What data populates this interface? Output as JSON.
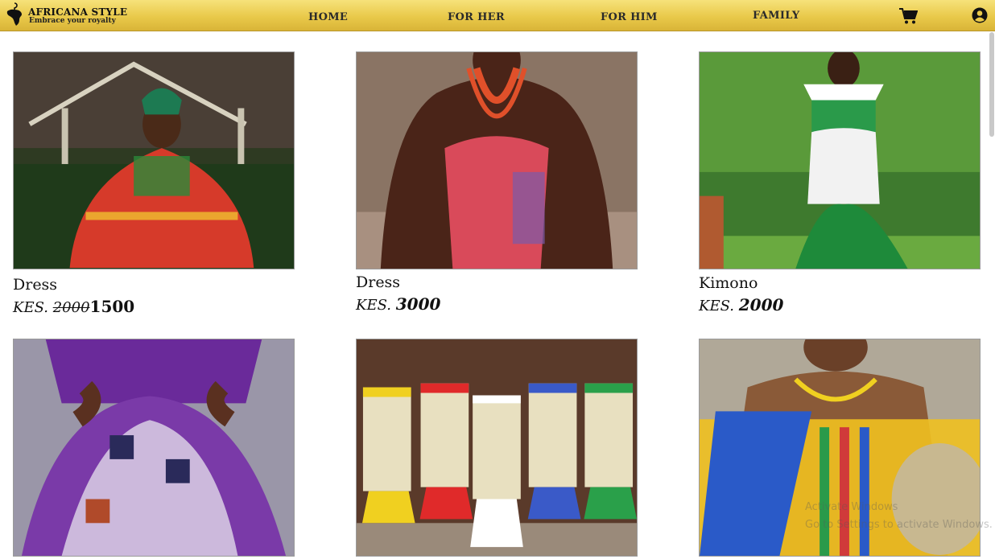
{
  "brand": {
    "title": "AFRICANA STYLE",
    "tagline": "Embrace your royalty"
  },
  "nav": {
    "home": "HOME",
    "for_her": "FOR HER",
    "for_him": "FOR HIM",
    "family": "FAMILY"
  },
  "icons": {
    "cart": "shopping-cart-icon",
    "account": "user-circle-icon"
  },
  "colors": {
    "header_gradient_top": "#f6e27a",
    "header_gradient_bottom": "#d9b437"
  },
  "products": [
    {
      "name": "Dress",
      "currency": "KES.",
      "old_price": "2000",
      "price": "1500"
    },
    {
      "name": "Dress",
      "currency": "KES.",
      "price": "3000"
    },
    {
      "name": "Kimono",
      "currency": "KES.",
      "price": "2000"
    },
    {
      "name": ""
    },
    {
      "name": ""
    },
    {
      "name": ""
    }
  ],
  "watermark": {
    "line1": "Activate Windows",
    "line2": "Go to Settings to activate Windows."
  }
}
